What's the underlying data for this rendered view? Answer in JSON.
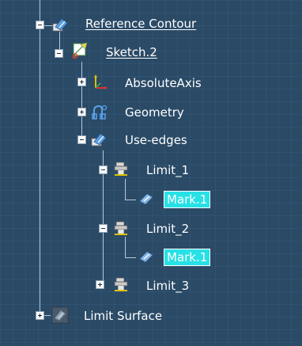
{
  "colors": {
    "background": "#2a4a66",
    "text": "#ffffff",
    "selection": "#27e1e6",
    "connector": "#b9c9d8"
  },
  "tree": {
    "reference_contour": {
      "label": "Reference Contour",
      "icon": "reference-contour-icon",
      "expanded": true
    },
    "sketch2": {
      "label": "Sketch.2",
      "icon": "sketch-icon",
      "expanded": true
    },
    "absolute_axis": {
      "label": "AbsoluteAxis",
      "icon": "axis-icon",
      "expanded": false
    },
    "geometry": {
      "label": "Geometry",
      "icon": "geometry-icon",
      "expanded": false
    },
    "use_edges": {
      "label": "Use-edges",
      "icon": "use-edges-icon",
      "expanded": true
    },
    "limit1": {
      "label": "Limit_1",
      "icon": "limit-icon",
      "expanded": true
    },
    "mark1_a": {
      "label": "Mark.1",
      "icon": "mark-icon",
      "selected": true
    },
    "limit2": {
      "label": "Limit_2",
      "icon": "limit-icon",
      "expanded": true
    },
    "mark1_b": {
      "label": "Mark.1",
      "icon": "mark-icon",
      "selected": true
    },
    "limit3": {
      "label": "Limit_3",
      "icon": "limit-icon",
      "expanded": false
    },
    "limit_surface": {
      "label": "Limit Surface",
      "icon": "limit-surface-icon",
      "expanded": false
    }
  }
}
